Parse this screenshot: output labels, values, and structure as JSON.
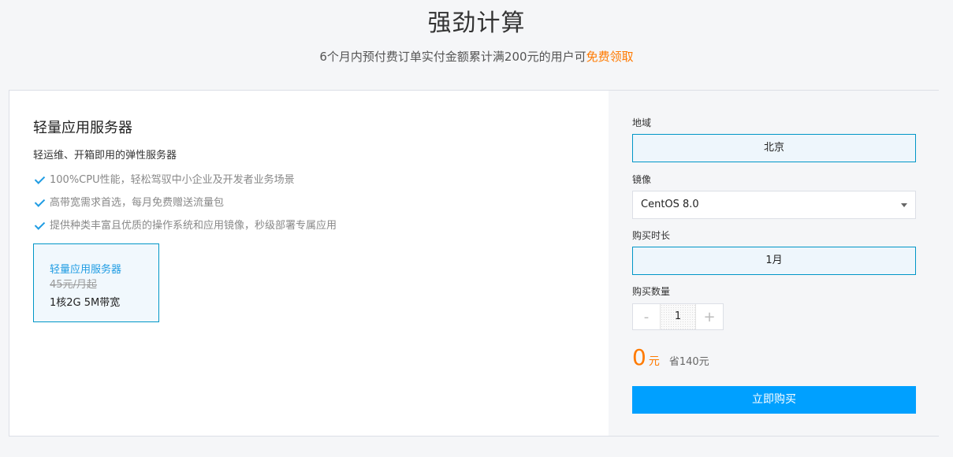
{
  "hero": {
    "title": "强劲计算",
    "subtitle": "6个月内预付费订单实付金额累计满200元的用户可",
    "free_link": "免费领取"
  },
  "product": {
    "title": "轻量应用服务器",
    "description": "轻运维、开箱即用的弹性服务器",
    "features": [
      "100%CPU性能，轻松驾驭中小企业及开发者业务场景",
      "高带宽需求首选，每月免费赠送流量包",
      "提供种类丰富且优质的操作系统和应用镜像，秒级部署专属应用"
    ],
    "spec_card": {
      "name": "轻量应用服务器",
      "original_price": "45元/月起",
      "detail": "1核2G 5M带宽"
    }
  },
  "config": {
    "region": {
      "label": "地域",
      "value": "北京"
    },
    "image": {
      "label": "镜像",
      "value": "CentOS 8.0"
    },
    "duration": {
      "label": "购买时长",
      "value": "1月"
    },
    "quantity": {
      "label": "购买数量",
      "value": "1",
      "minus": "-",
      "plus": "+"
    },
    "price": {
      "amount": "0",
      "unit": "元",
      "saving": "省140元"
    },
    "buy_label": "立即购买"
  },
  "colors": {
    "accent": "#00a0ff",
    "price": "#ff7a00",
    "selected_border": "#0096c7",
    "check": "#1f9ce3"
  },
  "icons": {
    "feature_check": "check-icon",
    "select_arrow": "caret-down-icon"
  }
}
